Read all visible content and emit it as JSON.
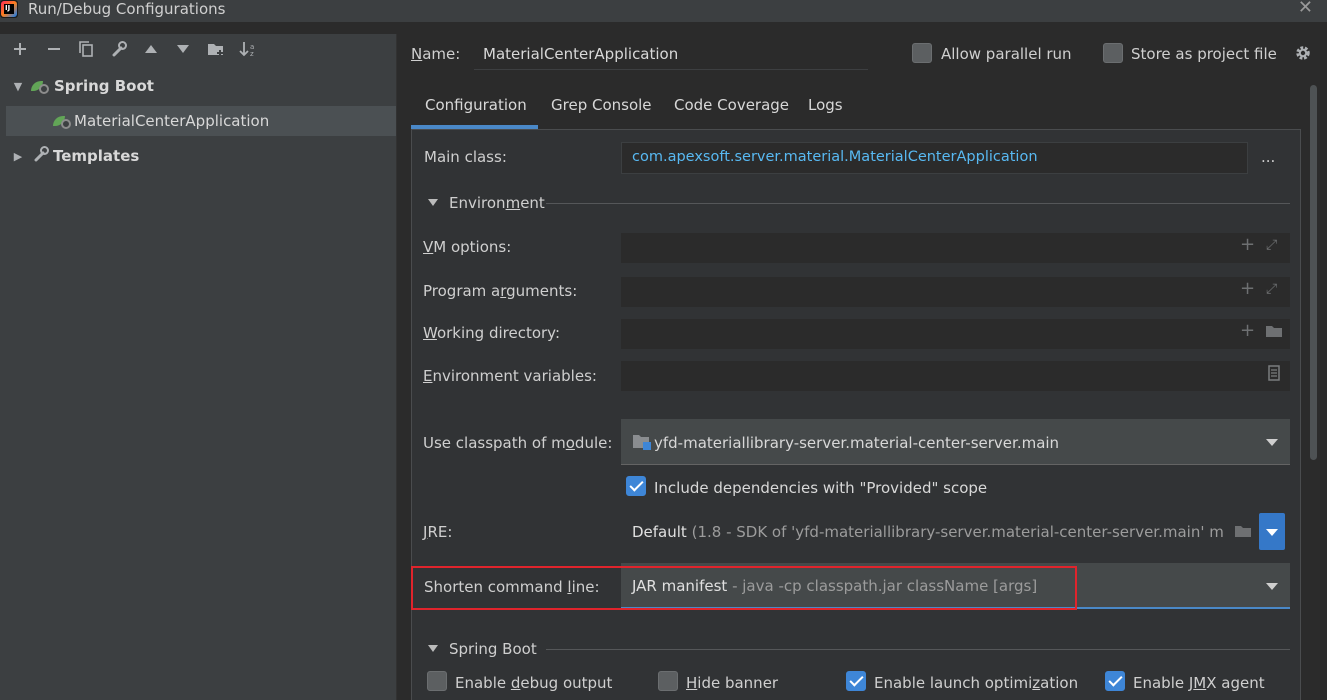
{
  "window": {
    "title": "Run/Debug Configurations",
    "close": "✕"
  },
  "toolbar": {
    "add": "+",
    "remove": "−",
    "copy": "⧉",
    "edit": "🔧",
    "up": "▲",
    "down": "▼",
    "folder": "📁",
    "sort": "↓ᵃᶻ"
  },
  "tree": {
    "spring_boot": "Spring Boot",
    "app": "MaterialCenterApplication",
    "templates": "Templates"
  },
  "header": {
    "name_label": "Name:",
    "name_value": "MaterialCenterApplication",
    "allow_parallel_run": "Allow parallel run",
    "store_as_project_file": "Store as project file"
  },
  "tabs": [
    {
      "label": "Configuration"
    },
    {
      "label": "Grep Console"
    },
    {
      "label": "Code Coverage"
    },
    {
      "label": "Logs"
    }
  ],
  "form": {
    "main_class_label": "Main class:",
    "main_class_value": "com.apexsoft.server.material.MaterialCenterApplication",
    "browse": "...",
    "environment_section": "Environment",
    "vm_options_label": "VM options:",
    "program_arguments_label": "Program arguments:",
    "working_directory_label": "Working directory:",
    "environment_variables_label": "Environment variables:",
    "use_classpath_label": "Use classpath of module:",
    "module_value": "yfd-materiallibrary-server.material-center-server.main",
    "include_dependencies": "Include dependencies with \"Provided\" scope",
    "include_dependencies_checked": true,
    "jre_label": "JRE:",
    "jre_value_main": "Default",
    "jre_value_detail": "(1.8 - SDK of 'yfd-materiallibrary-server.material-center-server.main' m",
    "shorten_label": "Shorten command line:",
    "shorten_value_main": "JAR manifest",
    "shorten_value_detail": "- java -cp classpath.jar className [args]",
    "spring_boot_section": "Spring Boot",
    "enable_debug_output": "Enable debug output",
    "enable_debug_output_checked": false,
    "hide_banner": "Hide banner",
    "hide_banner_checked": false,
    "enable_launch_optimization": "Enable launch optimization",
    "enable_launch_optimization_checked": true,
    "enable_jmx_agent": "Enable JMX agent",
    "enable_jmx_agent_checked": true
  }
}
